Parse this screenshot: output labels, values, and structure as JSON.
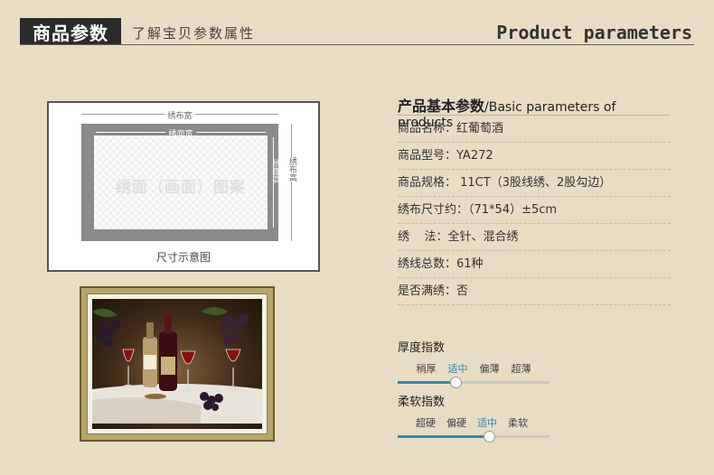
{
  "header": {
    "badge": "商品参数",
    "subtitle": "了解宝贝参数属性",
    "english": "Product parameters"
  },
  "diagram": {
    "cloth_width": "绣布宽",
    "face_width": "绣面宽",
    "face_height": "绣面高",
    "cloth_height": "绣布高",
    "watermark": "绣面（画面）图案",
    "caption": "尺寸示意图"
  },
  "params": {
    "title_cn": "产品基本参数",
    "title_en": "/Basic parameters of products",
    "rows": [
      "商品名称：红葡萄酒",
      "商品型号：YA272",
      "商品规格： 11CT（3股线绣、2股勾边）",
      "绣布尺寸约：（71*54）±5cm",
      "绣    法：全针、混合绣",
      "绣线总数：61种",
      "是否满绣：否"
    ]
  },
  "thickness": {
    "title": "厚度指数",
    "options": [
      "稍厚",
      "适中",
      "偏薄",
      "超薄"
    ],
    "active": "适中",
    "level": 0.38
  },
  "softness": {
    "title": "柔软指数",
    "options": [
      "超硬",
      "偏硬",
      "适中",
      "柔软"
    ],
    "active": "适中",
    "level": 0.6
  },
  "colors": {
    "accent": "#2a8ab8",
    "background": "#e8dcc4"
  }
}
